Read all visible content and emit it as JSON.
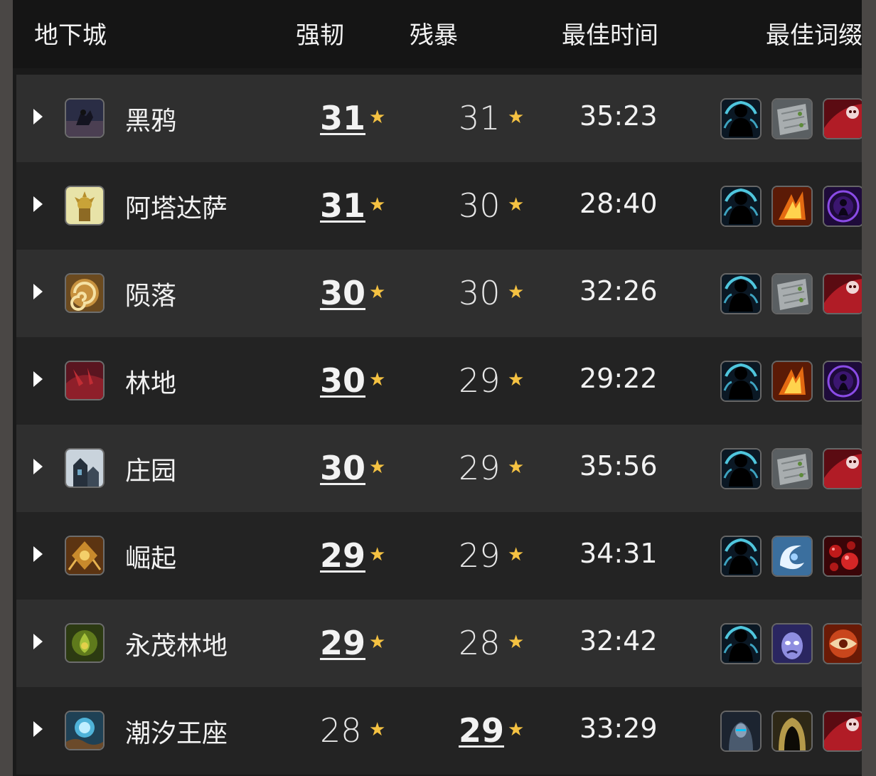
{
  "header": {
    "dungeon": "地下城",
    "fortified": "强韧",
    "tyrannical": "残暴",
    "best_time": "最佳时间",
    "best_affix": "最佳词缀"
  },
  "star_glyph": "★",
  "rows": [
    {
      "name": "黑鸦",
      "fortified": "31",
      "tyrannical": "31",
      "best": "fortified",
      "time": "35:23",
      "icon": "black-rook-hold-icon",
      "affixes": [
        "shadow-figure-icon",
        "stone-tablet-icon",
        "red-skull-icon"
      ]
    },
    {
      "name": "阿塔达萨",
      "fortified": "31",
      "tyrannical": "30",
      "best": "fortified",
      "time": "28:40",
      "icon": "atal-dazar-icon",
      "affixes": [
        "shadow-figure-icon",
        "fire-burst-icon",
        "purple-rune-icon"
      ]
    },
    {
      "name": "陨落",
      "fortified": "30",
      "tyrannical": "30",
      "best": "fortified",
      "time": "32:26",
      "icon": "swirl-vortex-icon",
      "affixes": [
        "shadow-figure-icon",
        "stone-tablet-icon",
        "red-skull-icon"
      ]
    },
    {
      "name": "林地",
      "fortified": "30",
      "tyrannical": "29",
      "best": "fortified",
      "time": "29:22",
      "icon": "darkheart-thicket-icon",
      "affixes": [
        "shadow-figure-icon",
        "fire-burst-icon",
        "purple-rune-icon"
      ]
    },
    {
      "name": "庄园",
      "fortified": "30",
      "tyrannical": "29",
      "best": "fortified",
      "time": "35:56",
      "icon": "waycrest-manor-icon",
      "affixes": [
        "shadow-figure-icon",
        "stone-tablet-icon",
        "red-skull-icon"
      ]
    },
    {
      "name": "崛起",
      "fortified": "29",
      "tyrannical": "29",
      "best": "fortified",
      "time": "34:31",
      "icon": "golden-rise-icon",
      "affixes": [
        "shadow-figure-icon",
        "ice-swirl-icon",
        "red-bubbles-icon"
      ]
    },
    {
      "name": "永茂林地",
      "fortified": "29",
      "tyrannical": "28",
      "best": "fortified",
      "time": "32:42",
      "icon": "everbloom-icon",
      "affixes": [
        "shadow-figure-icon",
        "blue-face-icon",
        "red-eye-icon"
      ]
    },
    {
      "name": "潮汐王座",
      "fortified": "28",
      "tyrannical": "29",
      "best": "tyrannical",
      "time": "33:29",
      "icon": "throne-of-tides-icon",
      "affixes": [
        "hooded-warrior-icon",
        "dark-hood-icon",
        "red-skull-icon"
      ]
    }
  ]
}
